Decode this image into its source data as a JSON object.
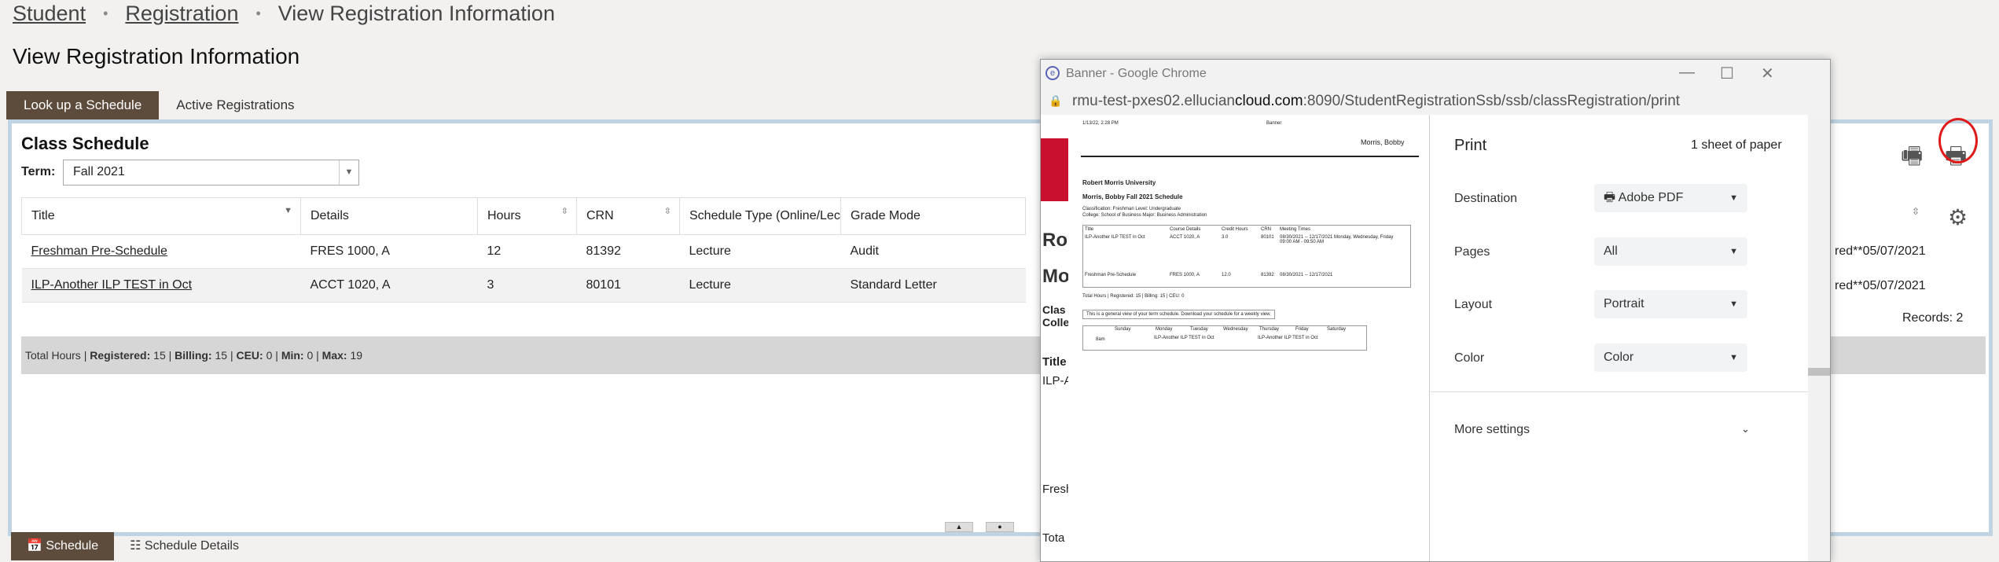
{
  "breadcrumb": {
    "student": "Student",
    "registration": "Registration",
    "current": "View Registration Information",
    "sep": "•"
  },
  "page_title": "View Registration Information",
  "tabs": [
    "Look up a Schedule",
    "Active Registrations"
  ],
  "schedule": {
    "title": "Class Schedule",
    "term_label": "Term:",
    "term_value": "Fall 2021",
    "columns": [
      "Title",
      "Details",
      "Hours",
      "CRN",
      "Schedule Type (Online/Lectu",
      "Grade Mode"
    ],
    "rows": [
      {
        "title": "Freshman Pre-Schedule",
        "details": "FRES 1000, A",
        "hours": "12",
        "crn": "81392",
        "type": "Lecture",
        "grade": "Audit",
        "right": "red**05/07/2021"
      },
      {
        "title": "ILP-Another ILP TEST in Oct",
        "details": "ACCT 1020, A",
        "hours": "3",
        "crn": "80101",
        "type": "Lecture",
        "grade": "Standard Letter",
        "right": "red**05/07/2021"
      }
    ],
    "totals": {
      "label": "Total Hours |",
      "registered_label": "Registered:",
      "registered": "15 |",
      "billing_label": "Billing:",
      "billing": "15 |",
      "ceu_label": "CEU:",
      "ceu": "0 |",
      "min_label": "Min:",
      "min": "0 |",
      "max_label": "Max:",
      "max": "19"
    },
    "records": "Records: 2"
  },
  "bottom_tabs": [
    "Schedule",
    "Schedule Details"
  ],
  "chrome": {
    "title": "Banner - Google Chrome",
    "url_host": "rmu-test-pxes02.ellucian",
    "url_host2": "cloud.com",
    "url_rest": ":8090/StudentRegistrationSsb/ssb/classRegistration/print"
  },
  "background_page": {
    "text1": "Ro",
    "text2": "Mo",
    "text3": "Clas",
    "text4": "Colle",
    "text5": "Title",
    "text6": "ILP-A",
    "text7": "Fresh",
    "text8": "Tota"
  },
  "preview": {
    "date": "1/13/22, 2:28 PM",
    "site": "Banner",
    "name": "Morris, Bobby",
    "university": "Robert Morris University",
    "sched_title": "Morris, Bobby Fall 2021 Schedule",
    "classification": "Classification: Freshman Level: Undergraduate",
    "college": "College: School of Business Major: Business Administration",
    "headers": [
      "Title",
      "Course Details",
      "Credit Hours",
      "CRN",
      "Meeting Times"
    ],
    "row1": [
      "ILP-Another ILP TEST in Oct",
      "ACCT 1020, A",
      "3.0",
      "80101",
      "08/30/2021 -- 12/17/2021 Monday, Wednesday, Friday 09:00 AM - 09:50 AM"
    ],
    "row2": [
      "Freshman Pre-Schedule",
      "FRES 1000, A",
      "12.0",
      "81392",
      "08/30/2021 -- 12/17/2021"
    ],
    "totals": "Total Hours | Registered: 15 | Billing: 15 | CEU: 0",
    "note": "This is a general view of your term schedule. Download your schedule for a weekly view.",
    "days": [
      "Sunday",
      "Monday",
      "Tuesday",
      "Wednesday",
      "Thursday",
      "Friday",
      "Saturday"
    ],
    "time": "8am",
    "cell": "ILP-Another ILP TEST in Oct"
  },
  "print": {
    "title": "Print",
    "sheets": "1 sheet of paper",
    "destination_label": "Destination",
    "destination": "Adobe PDF",
    "pages_label": "Pages",
    "pages": "All",
    "layout_label": "Layout",
    "layout": "Portrait",
    "color_label": "Color",
    "color": "Color",
    "more": "More settings"
  }
}
